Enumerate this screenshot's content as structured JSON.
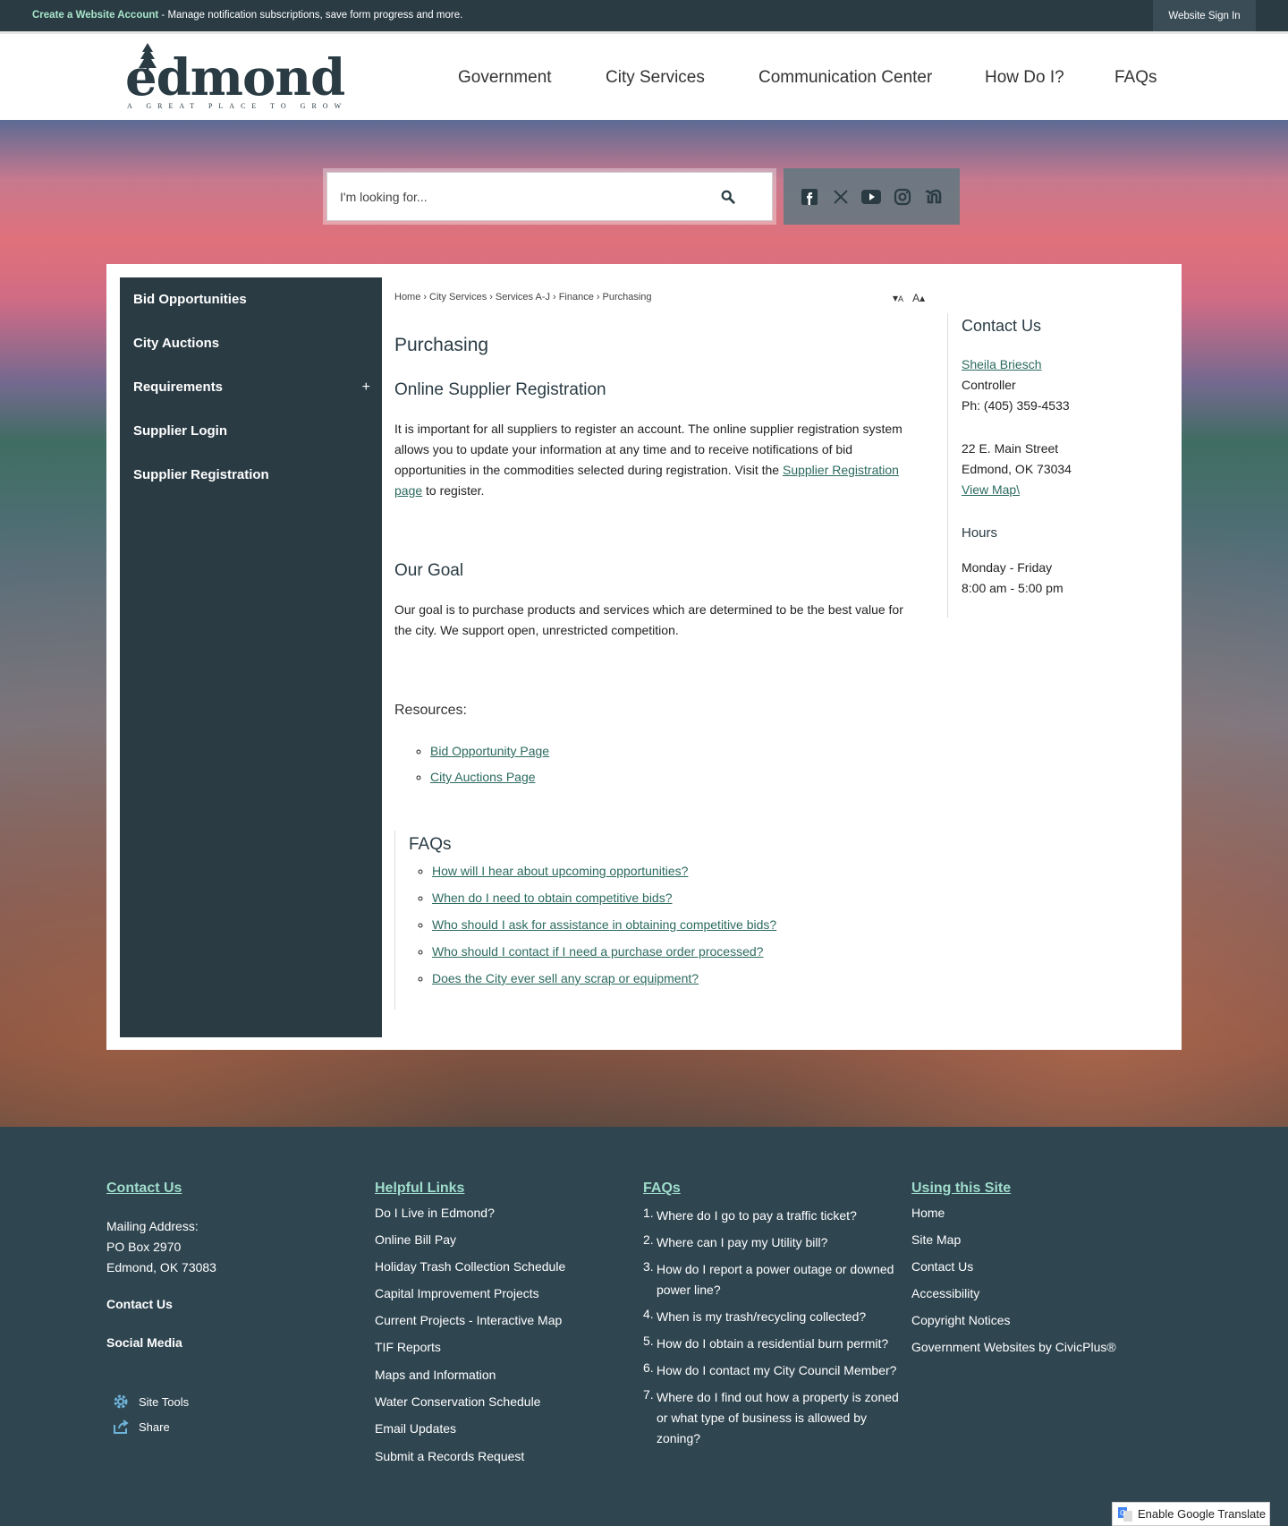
{
  "topbar": {
    "create_account": "Create a Website Account",
    "promo_text": " - Manage notification subscriptions, save form progress and more.",
    "sign_in": "Website Sign In"
  },
  "header": {
    "logo_word": "edmond",
    "logo_tagline": "A GREAT PLACE TO GROW",
    "nav": [
      "Government",
      "City Services",
      "Communication Center",
      "How Do I?",
      "FAQs"
    ]
  },
  "search": {
    "placeholder": "I'm looking for..."
  },
  "social": [
    "facebook-icon",
    "x-icon",
    "youtube-icon",
    "instagram-icon",
    "nextdoor-icon"
  ],
  "sidenav": {
    "items": [
      "Bid Opportunities",
      "City Auctions",
      "Requirements",
      "Supplier Login",
      "Supplier Registration"
    ],
    "expand_symbol": "+"
  },
  "breadcrumb": [
    "Home",
    "City Services",
    "Services A-J",
    "Finance",
    "Purchasing"
  ],
  "breadcrumb_sep": "›",
  "text_resize": {
    "decrease": "A",
    "increase": "A"
  },
  "content": {
    "page_title": "Purchasing",
    "section1_title": "Online Supplier Registration",
    "section1_text": "It is important for all suppliers to register an account. The online supplier registration system allows you to update your information at any time and to receive notifications of bid opportunities in the commodities selected during registration. Visit the ",
    "section1_link": "Supplier Registration page",
    "section1_tail": " to register.",
    "section2_title": "Our Goal",
    "section2_text": "Our goal is to purchase products and services which are determined to be the best value for the city. We support open, unrestricted competition.",
    "resources_label": "Resources:",
    "resources": [
      "Bid Opportunity Page",
      "City Auctions Page"
    ],
    "faqs_title": "FAQs",
    "faqs": [
      "How will I hear about upcoming opportunities?",
      "When do I need to obtain competitive bids?",
      "Who should I ask for assistance in obtaining competitive bids?",
      "Who should I contact if I need a purchase order processed?",
      "Does the City ever sell any scrap or equipment?"
    ]
  },
  "contact_us": {
    "title": "Contact Us",
    "name": "Sheila Briesch",
    "role": "Controller",
    "phone": "Ph: (405) 359-4533",
    "address1": "22 E. Main Street",
    "address2": "Edmond, OK 73034",
    "map_link": "View Map\\",
    "hours_title": "Hours",
    "hours_days": "Monday - Friday",
    "hours_time": "8:00 am - 5:00 pm"
  },
  "footer": {
    "contact": {
      "title": "Contact Us",
      "mailing_label": "Mailing Address:",
      "po_box": "PO Box 2970",
      "city": "Edmond, OK 73083",
      "contact_link": "Contact Us",
      "social_link": "Social Media",
      "site_tools": "Site Tools",
      "share": "Share"
    },
    "helpful": {
      "title": "Helpful Links",
      "items": [
        "Do I Live in Edmond?",
        "Online Bill Pay",
        "Holiday Trash Collection Schedule",
        "Capital Improvement Projects",
        "Current Projects - Interactive Map",
        "TIF Reports",
        "Maps and Information",
        "Water Conservation Schedule",
        "Email Updates",
        "Submit a Records Request"
      ]
    },
    "faqs": {
      "title": "FAQs",
      "items": [
        "Where do I go to pay a traffic ticket?",
        "Where can I pay my Utility bill?",
        "How do I report a power outage or downed power line?",
        "When is my trash/recycling collected?",
        "How do I obtain a residential burn permit?",
        "How do I contact my City Council Member?",
        "Where do I find out how a property is zoned or what type of business is allowed by zoning?"
      ],
      "numbers": [
        "1.",
        "2.",
        "3.",
        "4.",
        "5.",
        "6.",
        "7."
      ]
    },
    "using": {
      "title": "Using this Site",
      "items": [
        "Home",
        "Site Map",
        "Contact Us",
        "Accessibility",
        "Copyright Notices",
        "Government Websites by CivicPlus®"
      ]
    }
  },
  "translate": "Enable Google Translate",
  "colors": {
    "dark_slate": "#2a3b44",
    "footer_bg": "#2f4550",
    "link_green": "#2b6a5e",
    "footer_heading": "#9fdccb"
  }
}
